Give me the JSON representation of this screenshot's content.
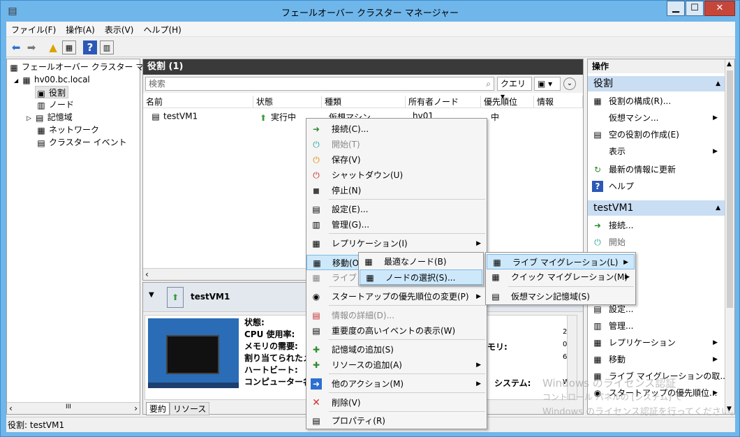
{
  "window": {
    "title": "フェールオーバー クラスター マネージャー",
    "minimize": "▁",
    "maximize": "☐",
    "close": "✕"
  },
  "menubar": [
    "ファイル(F)",
    "操作(A)",
    "表示(V)",
    "ヘルプ(H)"
  ],
  "tree": {
    "root": "フェールオーバー クラスター マネージ",
    "cluster": "hv00.bc.local",
    "items": [
      "役割",
      "ノード",
      "記憶域",
      "ネットワーク",
      "クラスター イベント"
    ]
  },
  "roles": {
    "header": "役割 (1)",
    "search_placeholder": "検索",
    "query_label": "クエリ",
    "columns": [
      "名前",
      "状態",
      "種類",
      "所有者ノード",
      "優先順位",
      "情報"
    ],
    "row": {
      "name": "testVM1",
      "status": "実行中",
      "type": "仮想マシン",
      "owner": "hv01",
      "priority": "中"
    }
  },
  "details": {
    "title": "testVM1",
    "labels": [
      "状態:",
      "CPU 使用率:",
      "メモリの需要:",
      "割り当てられたメモ",
      "ハートビート:",
      "コンピューター名:"
    ],
    "right_labels": [
      "モリ:",
      "システム:"
    ],
    "right_values": [
      "2:",
      "0",
      "6.",
      "Wi"
    ],
    "tabs": [
      "要約",
      "リソース"
    ]
  },
  "context_menu": {
    "items": [
      {
        "label": "接続(C)...",
        "icon": "connect-icon"
      },
      {
        "label": "開始(T)",
        "icon": "start-icon",
        "disabled": true
      },
      {
        "label": "保存(V)",
        "icon": "save-icon"
      },
      {
        "label": "シャットダウン(U)",
        "icon": "shutdown-icon"
      },
      {
        "label": "停止(N)",
        "icon": "stop-icon"
      },
      {
        "label": "設定(E)...",
        "icon": "settings-icon"
      },
      {
        "label": "管理(G)...",
        "icon": "manage-icon"
      },
      {
        "label": "レプリケーション(I)",
        "icon": "replication-icon",
        "submenu": true
      },
      {
        "label": "移動(O)",
        "icon": "move-icon",
        "submenu": true
      },
      {
        "label": "ライブ マ",
        "icon": "live-migration-icon",
        "disabled": true
      },
      {
        "label": "スタートアップの優先順位の変更(P)",
        "icon": "priority-icon",
        "submenu": true
      },
      {
        "label": "情報の詳細(D)...",
        "icon": "info-icon",
        "disabled": true
      },
      {
        "label": "重要度の高いイベントの表示(W)",
        "icon": "events-icon"
      },
      {
        "label": "記憶域の追加(S)",
        "icon": "add-storage-icon"
      },
      {
        "label": "リソースの追加(A)",
        "icon": "add-resource-icon",
        "submenu": true
      },
      {
        "label": "他のアクション(M)",
        "icon": "more-actions-icon",
        "submenu": true
      },
      {
        "label": "削除(V)",
        "icon": "delete-icon"
      },
      {
        "label": "プロパティ(R)",
        "icon": "properties-icon"
      }
    ]
  },
  "move_submenu": [
    "最適なノード(B)",
    "ノードの選択(S)..."
  ],
  "migration_submenu": [
    "ライブ マイグレーション(L)",
    "クイック マイグレーション(M)",
    "仮想マシン記憶域(S)"
  ],
  "actions": {
    "header": "操作",
    "section1": "役割",
    "section1_items": [
      "役割の構成(R)...",
      "仮想マシン...",
      "空の役割の作成(E)",
      "表示",
      "最新の情報に更新",
      "ヘルプ"
    ],
    "section2": "testVM1",
    "section2_items": [
      "接続...",
      "開始",
      "",
      "ウン",
      "設定...",
      "管理...",
      "レプリケーション",
      "移動",
      "ライブ マイグレーションの取...",
      "スタートアップの優先順位..."
    ]
  },
  "status": {
    "text": "役割:  testVM1"
  },
  "watermark": [
    "Windows のライセンス認証",
    "コントロール パネルの [システム] で",
    "Windows のライセンス認証を行ってください。"
  ],
  "scroll_glyph": "III",
  "tree_toggle_expanded": "◢",
  "tree_toggle_collapsed": "▷"
}
